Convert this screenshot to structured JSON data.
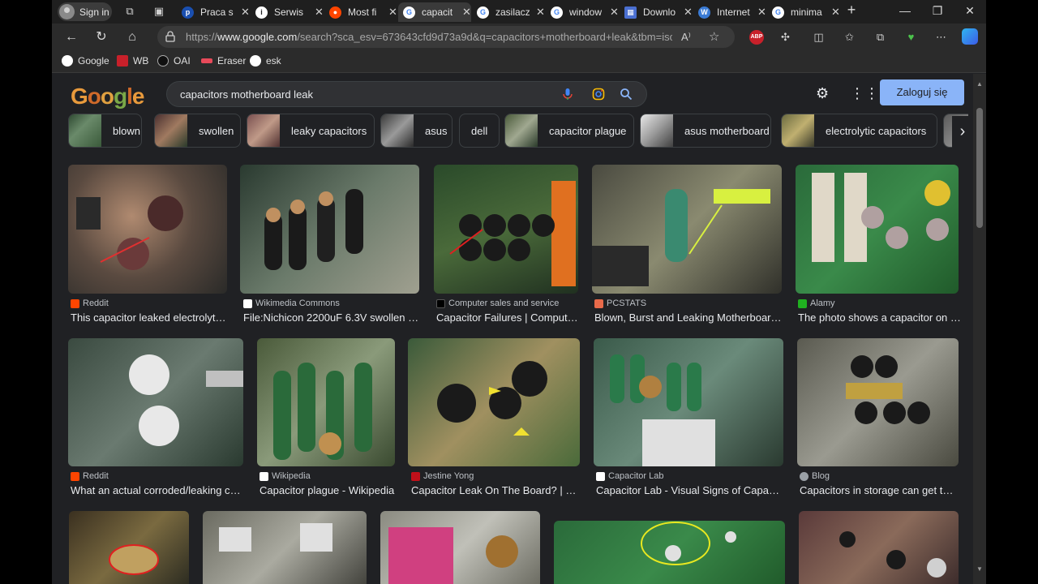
{
  "browser": {
    "signin_label": "Sign in",
    "tabs": [
      {
        "label": "Praca s",
        "color": "#1a4fb0",
        "glyph": "p"
      },
      {
        "label": "Serwis",
        "color": "#ffffff",
        "glyph": "i"
      },
      {
        "label": "Most fi",
        "color": "#ff4500",
        "glyph": "r"
      },
      {
        "label": "capacit",
        "color": "#ffffff",
        "glyph": "G"
      },
      {
        "label": "zasilacz",
        "color": "#ffffff",
        "glyph": "G"
      },
      {
        "label": "window",
        "color": "#ffffff",
        "glyph": "G"
      },
      {
        "label": "Downlo",
        "color": "#4a6fd1",
        "glyph": ""
      },
      {
        "label": "Internet",
        "color": "#3a7bd5",
        "glyph": "W"
      },
      {
        "label": "minima",
        "color": "#ffffff",
        "glyph": "G"
      }
    ],
    "url_prefix": "https://",
    "url_host": "www.google.com",
    "url_rest": "/search?sca_esv=673643cfd9d73a9d&q=capacitors+motherboard+leak&tbm=isch&so...",
    "extension_badge": "ABP",
    "bookmarks": [
      {
        "label": "Google"
      },
      {
        "label": "WB"
      },
      {
        "label": "OAI"
      },
      {
        "label": "Eraser"
      },
      {
        "label": "esk"
      }
    ]
  },
  "google": {
    "logo": "Google",
    "query": "capacitors motherboard leak",
    "login_label": "Zaloguj się",
    "chips": [
      {
        "label": "blown"
      },
      {
        "label": "swollen"
      },
      {
        "label": "leaky capacitors"
      },
      {
        "label": "asus"
      },
      {
        "label": "dell"
      },
      {
        "label": "capacitor plague"
      },
      {
        "label": "asus motherboard"
      },
      {
        "label": "electrolytic capacitors"
      }
    ],
    "results": [
      {
        "source": "Reddit",
        "title": "This capacitor leaked electrolyte...",
        "src_color": "#ff4500"
      },
      {
        "source": "Wikimedia Commons",
        "title": "File:Nichicon 2200uF 6.3V swollen le...",
        "src_color": "#ffffff"
      },
      {
        "source": "Computer sales and service",
        "title": "Capacitor Failures | Computer...",
        "src_color": "#000000"
      },
      {
        "source": "PCSTATS",
        "title": "Blown, Burst and Leaking Motherboard ...",
        "src_color": "#e86a4a"
      },
      {
        "source": "Alamy",
        "title": "The photo shows a capacitor on a...",
        "src_color": "#20b020"
      },
      {
        "source": "Reddit",
        "title": "What an actual corroded/leaking ca...",
        "src_color": "#ff4500"
      },
      {
        "source": "Wikipedia",
        "title": "Capacitor plague - Wikipedia",
        "src_color": "#ffffff"
      },
      {
        "source": "Jestine Yong",
        "title": "Capacitor Leak On The Board? | Ele...",
        "src_color": "#c0101a"
      },
      {
        "source": "Capacitor Lab",
        "title": "Capacitor Lab - Visual Signs of Capacit...",
        "src_color": "#ffffff"
      },
      {
        "source": "Blog",
        "title": "Capacitors in storage can get the ...",
        "src_color": "#9aa0a6"
      }
    ]
  }
}
